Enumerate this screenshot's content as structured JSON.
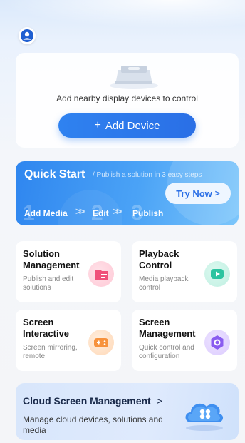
{
  "device_section": {
    "message": "Add nearby display devices to control",
    "add_button_label": "Add Device",
    "add_button_icon": "plus-icon"
  },
  "quick_start": {
    "title": "Quick Start",
    "subtitle": "/ Publish a solution in 3 easy steps",
    "try_label": "Try Now",
    "try_icon": "chevron-right-icon",
    "steps": [
      {
        "number": "1",
        "label": "Add Media"
      },
      {
        "number": "2",
        "label": "Edit"
      },
      {
        "number": "3",
        "label": "Publish"
      }
    ]
  },
  "features": [
    {
      "title": "Solution Management",
      "desc": "Publish and edit solutions",
      "icon": "folder-icon",
      "color": "#f0507a"
    },
    {
      "title": "Playback Control",
      "desc": "Media playback control",
      "icon": "play-icon",
      "color": "#2cc4a0"
    },
    {
      "title": "Screen Interactive",
      "desc": "Screen mirroring, remote",
      "icon": "gamepad-icon",
      "color": "#f7923c"
    },
    {
      "title": "Screen Management",
      "desc": "Quick control and configuration",
      "icon": "hexagon-icon",
      "color": "#8a5cf0"
    }
  ],
  "cloud": {
    "title": "Cloud Screen Management",
    "chevron": ">",
    "desc": "Manage cloud devices, solutions and media",
    "icon": "cloud-icon"
  },
  "colors": {
    "accent": "#2f82f0",
    "quick_start_bg": "#3b93f2"
  }
}
